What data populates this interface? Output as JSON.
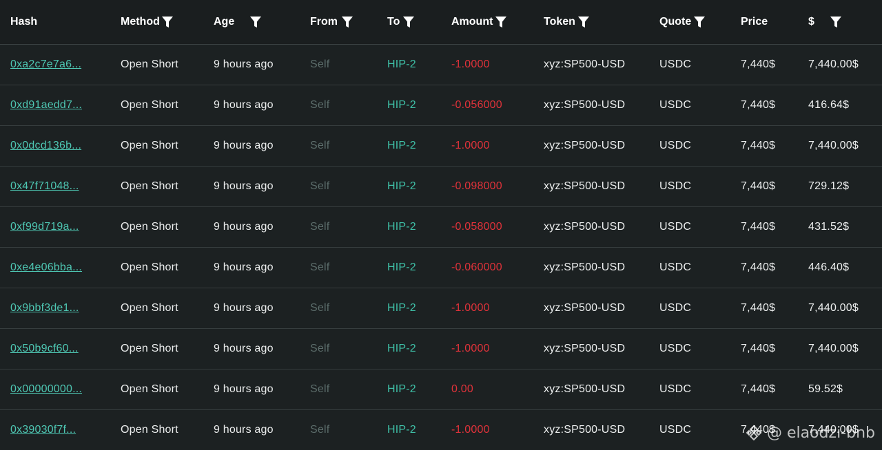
{
  "columns": {
    "hash": "Hash",
    "method": "Method",
    "age": "Age",
    "from": "From",
    "to": "To",
    "amount": "Amount",
    "token": "Token",
    "quote": "Quote",
    "price": "Price",
    "usd": "$"
  },
  "rows": [
    {
      "hash": "0xa2c7e7a6...",
      "method": "Open Short",
      "age": "9 hours ago",
      "from": "Self",
      "to": "HIP-2",
      "amount": "-1.0000",
      "token": "xyz:SP500-USD",
      "quote": "USDC",
      "price": "7,440$",
      "usd": "7,440.00$"
    },
    {
      "hash": "0xd91aedd7...",
      "method": "Open Short",
      "age": "9 hours ago",
      "from": "Self",
      "to": "HIP-2",
      "amount": "-0.056000",
      "token": "xyz:SP500-USD",
      "quote": "USDC",
      "price": "7,440$",
      "usd": "416.64$"
    },
    {
      "hash": "0x0dcd136b...",
      "method": "Open Short",
      "age": "9 hours ago",
      "from": "Self",
      "to": "HIP-2",
      "amount": "-1.0000",
      "token": "xyz:SP500-USD",
      "quote": "USDC",
      "price": "7,440$",
      "usd": "7,440.00$"
    },
    {
      "hash": "0x47f71048...",
      "method": "Open Short",
      "age": "9 hours ago",
      "from": "Self",
      "to": "HIP-2",
      "amount": "-0.098000",
      "token": "xyz:SP500-USD",
      "quote": "USDC",
      "price": "7,440$",
      "usd": "729.12$"
    },
    {
      "hash": "0xf99d719a...",
      "method": "Open Short",
      "age": "9 hours ago",
      "from": "Self",
      "to": "HIP-2",
      "amount": "-0.058000",
      "token": "xyz:SP500-USD",
      "quote": "USDC",
      "price": "7,440$",
      "usd": "431.52$"
    },
    {
      "hash": "0xe4e06bba...",
      "method": "Open Short",
      "age": "9 hours ago",
      "from": "Self",
      "to": "HIP-2",
      "amount": "-0.060000",
      "token": "xyz:SP500-USD",
      "quote": "USDC",
      "price": "7,440$",
      "usd": "446.40$"
    },
    {
      "hash": "0x9bbf3de1...",
      "method": "Open Short",
      "age": "9 hours ago",
      "from": "Self",
      "to": "HIP-2",
      "amount": "-1.0000",
      "token": "xyz:SP500-USD",
      "quote": "USDC",
      "price": "7,440$",
      "usd": "7,440.00$"
    },
    {
      "hash": "0x50b9cf60...",
      "method": "Open Short",
      "age": "9 hours ago",
      "from": "Self",
      "to": "HIP-2",
      "amount": "-1.0000",
      "token": "xyz:SP500-USD",
      "quote": "USDC",
      "price": "7,440$",
      "usd": "7,440.00$"
    },
    {
      "hash": "0x00000000...",
      "method": "Open Short",
      "age": "9 hours ago",
      "from": "Self",
      "to": "HIP-2",
      "amount": "0.00",
      "token": "xyz:SP500-USD",
      "quote": "USDC",
      "price": "7,440$",
      "usd": "59.52$"
    },
    {
      "hash": "0x39030f7f...",
      "method": "Open Short",
      "age": "9 hours ago",
      "from": "Self",
      "to": "HIP-2",
      "amount": "-1.0000",
      "token": "xyz:SP500-USD",
      "quote": "USDC",
      "price": "7,440$",
      "usd": "7,440.00$"
    }
  ],
  "watermark": {
    "text": "@ elaodzi-bnb",
    "icon": "binance-logo-icon"
  },
  "colors": {
    "background": "#1c2122",
    "header_background": "#1a1e1f",
    "hash_link": "#4ec7b3",
    "to_accent": "#3fc1a8",
    "from_muted": "#5c6d6b",
    "amount_negative": "#e0323a"
  }
}
